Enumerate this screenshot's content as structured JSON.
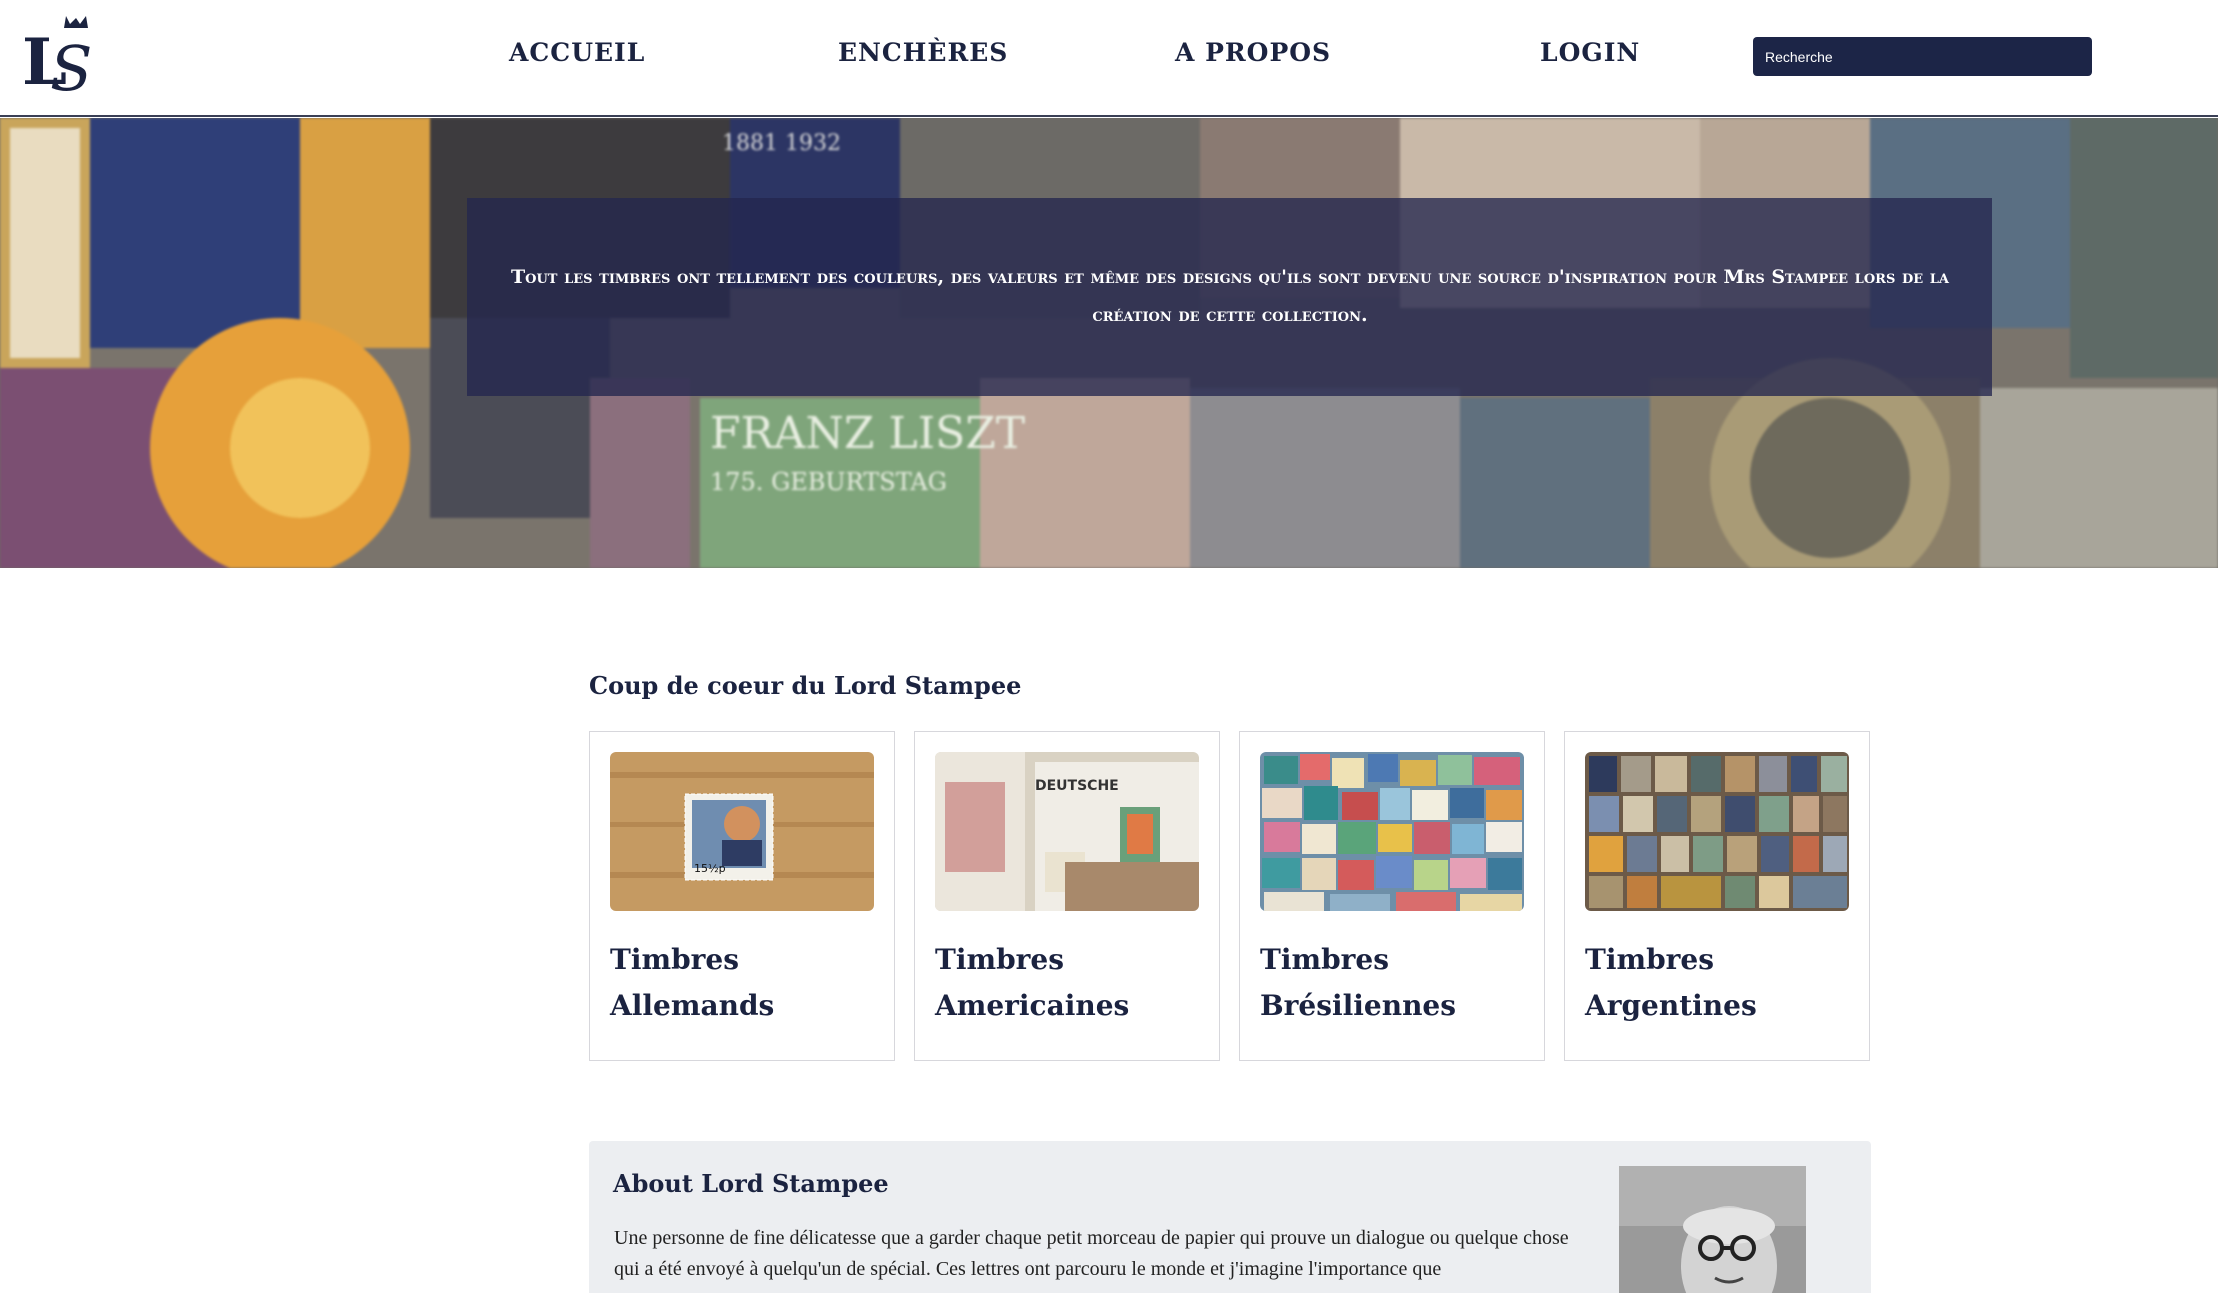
{
  "header": {
    "logo_alt": "LS",
    "nav": {
      "accueil": "ACCUEIL",
      "encheres": "ENCHÈRES",
      "apropos": "A PROPOS",
      "login": "LOGIN"
    },
    "search_placeholder": "Recherche"
  },
  "hero": {
    "text": "Tout les timbres ont tellement des couleurs, des valeurs et même des designs qu'ils sont devenu une source d'inspiration pour Mrs Stampee lors de la création de cette collection.",
    "stamp_texts": [
      "FRANZ LISZT",
      "175. GEBURTSTAG",
      "1881 1932",
      "DEUTSCHE"
    ]
  },
  "favorites": {
    "title": "Coup de coeur du Lord Stampee",
    "cards": [
      {
        "title": "Timbres Allemands",
        "image": "single-stamp-on-wood"
      },
      {
        "title": "Timbres Americaines",
        "image": "postcards-with-stamps"
      },
      {
        "title": "Timbres Brésiliennes",
        "image": "pile-of-stamps"
      },
      {
        "title": "Timbres Argentines",
        "image": "stamp-collection-portraits"
      }
    ]
  },
  "about": {
    "title": "About Lord Stampee",
    "text": "Une personne de fine délicatesse que a garder chaque petit morceau de papier qui prouve un dialogue ou quelque chose qui a été envoyé à quelqu'un de spécial. Ces lettres ont parcouru le monde et j'imagine l'importance que"
  },
  "colors": {
    "navy": "#1b2340",
    "search_bg": "#1c2547",
    "hero_overlay": "#24264e",
    "about_bg": "#eceef1"
  }
}
